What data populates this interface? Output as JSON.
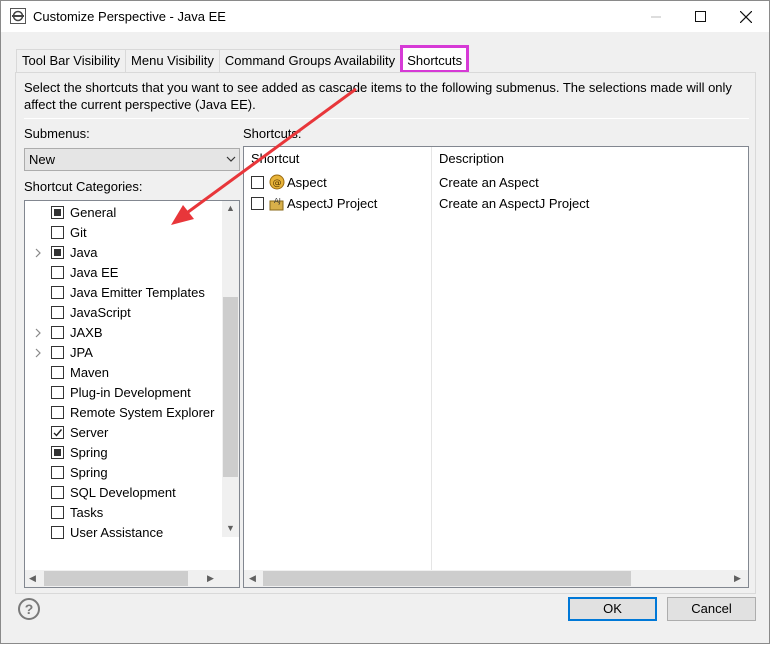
{
  "window": {
    "title": "Customize Perspective - Java EE",
    "controls": {
      "minimize": "minimize",
      "maximize": "maximize",
      "close": "close"
    }
  },
  "tabs": [
    {
      "label": "Tool Bar Visibility",
      "active": false
    },
    {
      "label": "Menu Visibility",
      "active": false
    },
    {
      "label": "Command Groups Availability",
      "active": false
    },
    {
      "label": "Shortcuts",
      "active": true
    }
  ],
  "description": "Select the shortcuts that you want to see added as cascade items to the following submenus.  The selections made will only affect the current perspective (Java EE).",
  "submenus": {
    "label": "Submenus:",
    "selected": "New"
  },
  "categories": {
    "label": "Shortcut Categories:",
    "items": [
      {
        "label": "General",
        "state": "partial",
        "expandable": false
      },
      {
        "label": "Git",
        "state": "unchecked",
        "expandable": false
      },
      {
        "label": "Java",
        "state": "partial",
        "expandable": true
      },
      {
        "label": "Java EE",
        "state": "unchecked",
        "expandable": false
      },
      {
        "label": "Java Emitter Templates",
        "state": "unchecked",
        "expandable": false
      },
      {
        "label": "JavaScript",
        "state": "unchecked",
        "expandable": false
      },
      {
        "label": "JAXB",
        "state": "unchecked",
        "expandable": true
      },
      {
        "label": "JPA",
        "state": "unchecked",
        "expandable": true
      },
      {
        "label": "Maven",
        "state": "unchecked",
        "expandable": false
      },
      {
        "label": "Plug-in Development",
        "state": "unchecked",
        "expandable": false
      },
      {
        "label": "Remote System Explorer",
        "state": "unchecked",
        "expandable": false
      },
      {
        "label": "Server",
        "state": "checked",
        "expandable": false
      },
      {
        "label": "Spring",
        "state": "partial",
        "expandable": false
      },
      {
        "label": "Spring",
        "state": "unchecked",
        "expandable": false
      },
      {
        "label": "SQL Development",
        "state": "unchecked",
        "expandable": false
      },
      {
        "label": "Tasks",
        "state": "unchecked",
        "expandable": false
      },
      {
        "label": "User Assistance",
        "state": "unchecked",
        "expandable": false
      }
    ]
  },
  "shortcuts": {
    "label": "Shortcuts:",
    "columns": [
      "Shortcut",
      "Description"
    ],
    "rows": [
      {
        "name": "Aspect",
        "description": "Create an Aspect",
        "icon": "aspect-icon",
        "checked": false
      },
      {
        "name": "AspectJ Project",
        "description": "Create an AspectJ Project",
        "icon": "aspectj-project-icon",
        "checked": false
      }
    ]
  },
  "buttons": {
    "ok": "OK",
    "cancel": "Cancel",
    "help": "?"
  },
  "colors": {
    "highlight": "#d63ad6",
    "annotation_arrow": "#e8363a",
    "default_button": "#0078d7"
  }
}
